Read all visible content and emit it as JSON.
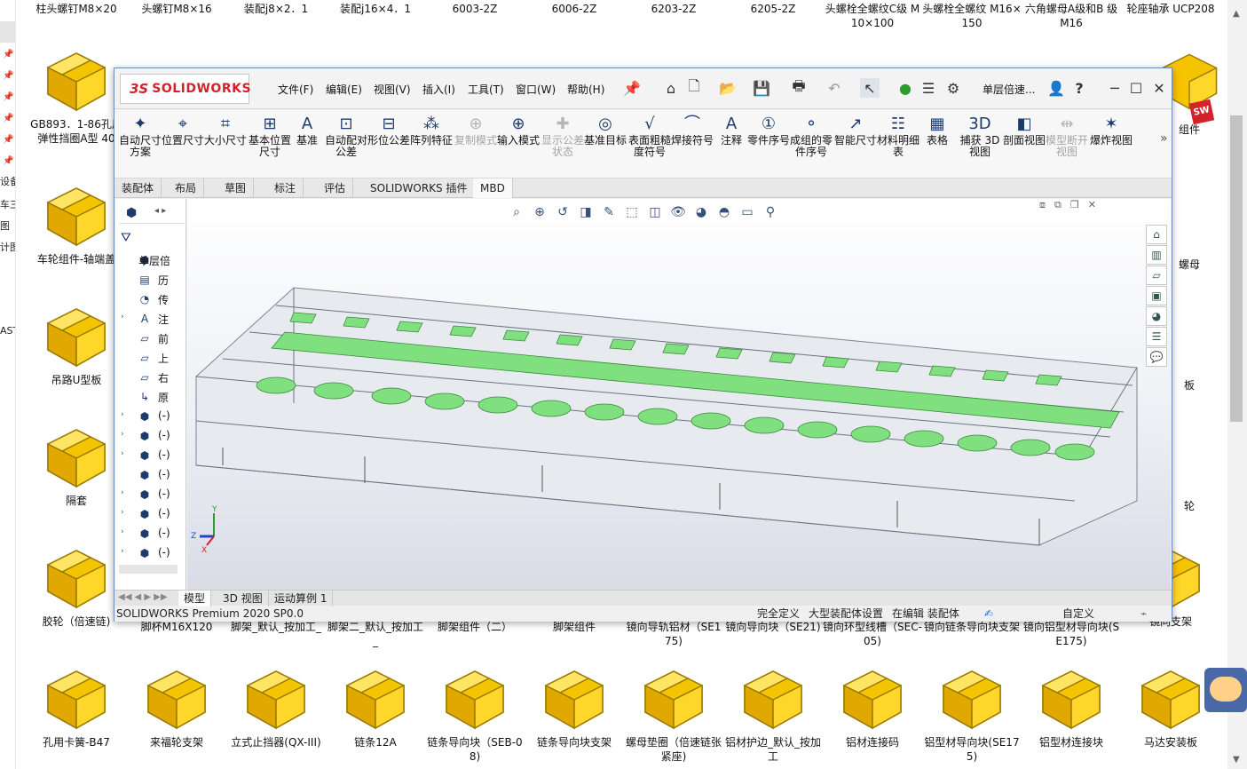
{
  "nav_strip": {
    "labels": [
      "设备",
      "车三",
      "图",
      "计图",
      "AST"
    ]
  },
  "desktop_top_row": [
    "柱头螺钉M8×20",
    "头螺钉M8×16",
    "装配j8×2．1",
    "装配j16×4．1",
    "6003-2Z",
    "6006-2Z",
    "6203-2Z",
    "6205-2Z",
    "头螺栓全螺纹C级 M10×100",
    "头螺栓全螺纹 M16×150",
    "六角螺母A级和B 级M16",
    "轮座轴承 UCP208"
  ],
  "desktop_items": {
    "col1": [
      "GB893．1-86孔用弹性挡圈A型 40",
      "车轮组件-轴端盖",
      "吊路U型板",
      "隔套",
      "胶轮（倍速链)",
      "孔用卡簧-B47"
    ],
    "row5": [
      "胶轮（倍速链)",
      "脚杯M16X120",
      "脚架_默认_按加工_",
      "脚架二_默认_按加工_",
      "脚架组件（二）",
      "脚架组件",
      "镜向导轨铝材（SE175)",
      "镜向导向块（SE21)",
      "镜向环型线槽（SEC-05)",
      "镜向链条导向块支架",
      "镜向铝型材导向块(SE175)",
      "镜向支架"
    ],
    "row6": [
      "孔用卡簧-B47",
      "来福轮支架",
      "立式止挡器(QX-III)",
      "链条12A",
      "链条导向块（SEB-08)",
      "链条导向块支架",
      "螺母垫圈（倍速链张紧座)",
      "铝材护边_默认_按加工",
      "铝材连接码",
      "铝型材导向块(SE175)",
      "铝型材连接块",
      "马达安装板"
    ],
    "right_partial": [
      "组件",
      "螺母",
      "板",
      "轮"
    ]
  },
  "solidworks": {
    "brand_ds": "3S",
    "brand_name": "SOLIDWORKS",
    "menus": [
      "文件(F)",
      "编辑(E)",
      "视图(V)",
      "插入(I)",
      "工具(T)",
      "窗口(W)",
      "帮助(H)"
    ],
    "doc_title": "单层倍速...",
    "commands": [
      {
        "label": "自动尺寸方案",
        "icon": "✦",
        "enabled": true
      },
      {
        "label": "位置尺寸",
        "icon": "⌖",
        "enabled": true
      },
      {
        "label": "大小尺寸",
        "icon": "⌗",
        "enabled": true
      },
      {
        "label": "基本位置尺寸",
        "icon": "⊞",
        "enabled": true
      },
      {
        "label": "基准",
        "icon": "A",
        "enabled": true
      },
      {
        "label": "自动配对公差",
        "icon": "⊡",
        "enabled": true
      },
      {
        "label": "形位公差",
        "icon": "⊟",
        "enabled": true
      },
      {
        "label": "阵列特征",
        "icon": "⁂",
        "enabled": true
      },
      {
        "label": "复制模式",
        "icon": "⊕",
        "enabled": false
      },
      {
        "label": "输入模式",
        "icon": "⊕",
        "enabled": true
      },
      {
        "label": "显示公差状态",
        "icon": "✚",
        "enabled": false
      },
      {
        "label": "基准目标",
        "icon": "◎",
        "enabled": true
      },
      {
        "label": "表面粗糙度符号",
        "icon": "√",
        "enabled": true
      },
      {
        "label": "焊接符号",
        "icon": "⌒",
        "enabled": true
      },
      {
        "label": "注释",
        "icon": "A",
        "enabled": true
      },
      {
        "label": "零件序号",
        "icon": "①",
        "enabled": true
      },
      {
        "label": "成组的零件序号",
        "icon": "⚬",
        "enabled": true
      },
      {
        "label": "智能尺寸",
        "icon": "↗",
        "enabled": true
      },
      {
        "label": "材料明细表",
        "icon": "☷",
        "enabled": true
      },
      {
        "label": "表格",
        "icon": "▦",
        "enabled": true
      },
      {
        "label": "捕获 3D 视图",
        "icon": "3D",
        "enabled": true
      },
      {
        "label": "剖面视图",
        "icon": "◧",
        "enabled": true
      },
      {
        "label": "模型断开视图",
        "icon": "⇹",
        "enabled": false
      },
      {
        "label": "爆炸视图",
        "icon": "✶",
        "enabled": true
      }
    ],
    "tabs": [
      "装配体",
      "布局",
      "草图",
      "标注",
      "评估",
      "SOLIDWORKS 插件",
      "MBD"
    ],
    "active_tab": "MBD",
    "tree": [
      {
        "label": "单层倍",
        "icon": "⬢",
        "arrow": ""
      },
      {
        "label": "历",
        "icon": "▤",
        "arrow": ""
      },
      {
        "label": "传",
        "icon": "◔",
        "arrow": ""
      },
      {
        "label": "注",
        "icon": "A",
        "arrow": "›"
      },
      {
        "label": "前",
        "icon": "▱",
        "arrow": ""
      },
      {
        "label": "上",
        "icon": "▱",
        "arrow": ""
      },
      {
        "label": "右",
        "icon": "▱",
        "arrow": ""
      },
      {
        "label": "原",
        "icon": "↳",
        "arrow": ""
      },
      {
        "label": "(-)",
        "icon": "⬢",
        "arrow": "›"
      },
      {
        "label": "(-)",
        "icon": "⬢",
        "arrow": "›"
      },
      {
        "label": "(-)",
        "icon": "⬢",
        "arrow": "›"
      },
      {
        "label": "(-)",
        "icon": "⬢",
        "arrow": ""
      },
      {
        "label": "(-)",
        "icon": "⬢",
        "arrow": "›"
      },
      {
        "label": "(-)",
        "icon": "⬢",
        "arrow": "›"
      },
      {
        "label": "(-)",
        "icon": "⬢",
        "arrow": "›"
      },
      {
        "label": "(-)",
        "icon": "⬢",
        "arrow": "›"
      }
    ],
    "bottom_tabs": [
      "模型",
      "3D 视图",
      "运动算例 1"
    ],
    "status": {
      "product": "SOLIDWORKS Premium 2020 SP0.0",
      "state1": "完全定义",
      "state2": "大型装配体设置",
      "state3": "在编辑 装配体",
      "custom": "自定义"
    },
    "triad": {
      "x": "X",
      "y": "Y",
      "z": "Z"
    }
  }
}
